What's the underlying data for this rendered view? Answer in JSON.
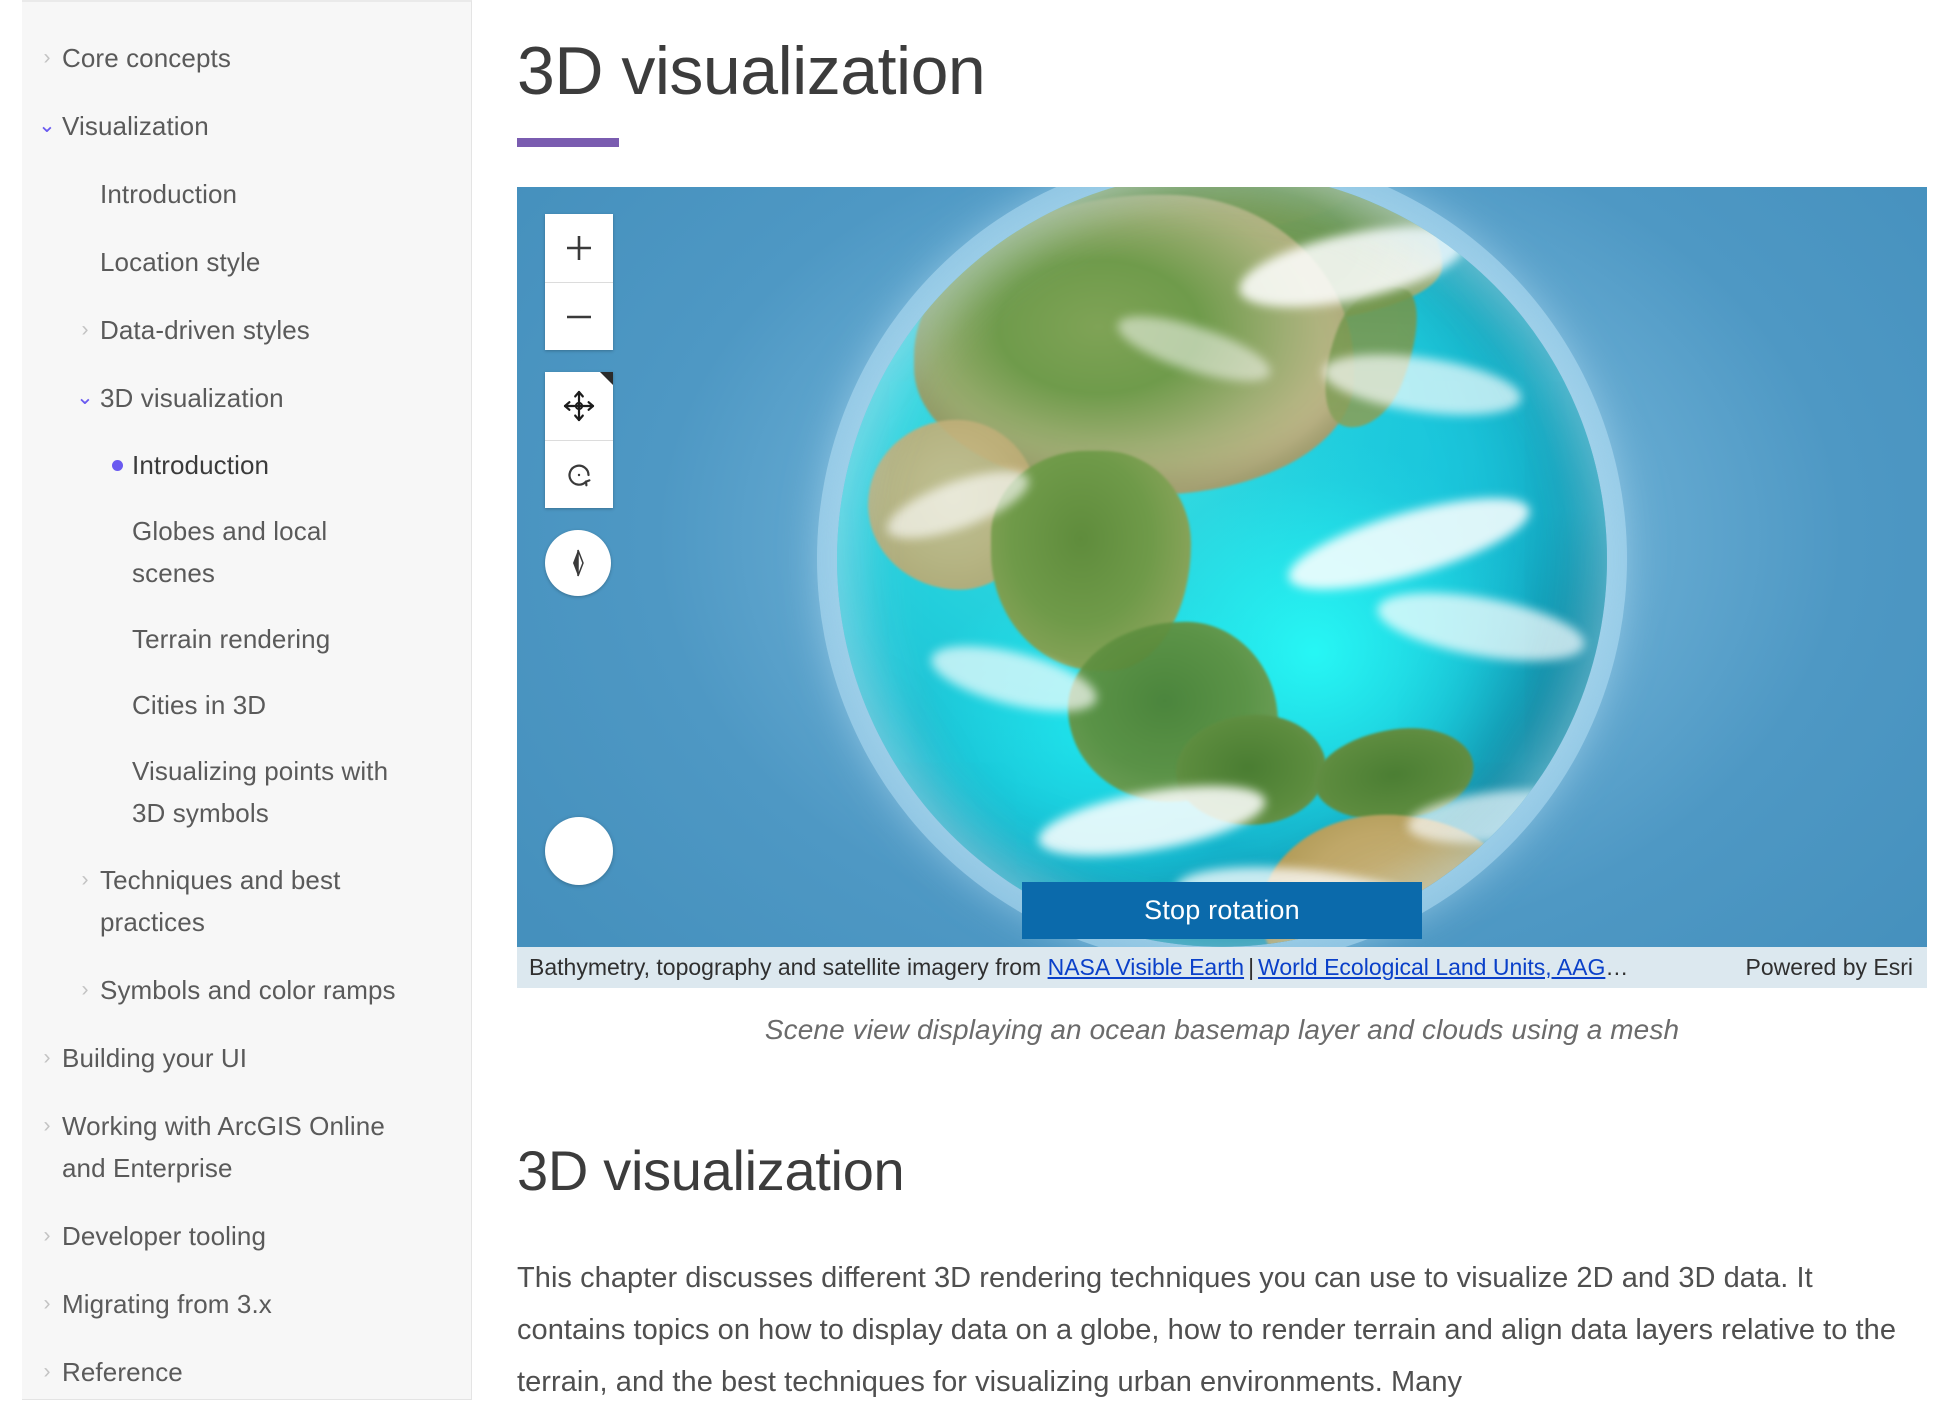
{
  "sidebar": {
    "items": [
      {
        "label": "Core concepts",
        "level": 0,
        "twist": "collapsed",
        "active": false
      },
      {
        "label": "Visualization",
        "level": 0,
        "twist": "expanded",
        "active": false
      },
      {
        "label": "Introduction",
        "level": 1,
        "twist": "none",
        "active": false
      },
      {
        "label": "Location style",
        "level": 1,
        "twist": "none",
        "active": false
      },
      {
        "label": "Data-driven styles",
        "level": 1,
        "twist": "collapsed",
        "active": false
      },
      {
        "label": "3D visualization",
        "level": 1,
        "twist": "expanded",
        "active": false
      },
      {
        "label": "Introduction",
        "level": 2,
        "twist": "bullet",
        "active": true
      },
      {
        "label": "Globes and local scenes",
        "level": 2,
        "twist": "none",
        "active": false
      },
      {
        "label": "Terrain rendering",
        "level": 2,
        "twist": "none",
        "active": false
      },
      {
        "label": "Cities in 3D",
        "level": 2,
        "twist": "none",
        "active": false
      },
      {
        "label": "Visualizing points with 3D symbols",
        "level": 2,
        "twist": "none",
        "active": false
      },
      {
        "label": "Techniques and best practices",
        "level": 1,
        "twist": "collapsed",
        "active": false
      },
      {
        "label": "Symbols and color ramps",
        "level": 1,
        "twist": "collapsed",
        "active": false
      },
      {
        "label": "Building your UI",
        "level": 0,
        "twist": "collapsed",
        "active": false
      },
      {
        "label": "Working with ArcGIS Online and Enterprise",
        "level": 0,
        "twist": "collapsed",
        "active": false
      },
      {
        "label": "Developer tooling",
        "level": 0,
        "twist": "collapsed",
        "active": false
      },
      {
        "label": "Migrating from 3.x",
        "level": 0,
        "twist": "collapsed",
        "active": false
      },
      {
        "label": "Reference",
        "level": 0,
        "twist": "collapsed",
        "active": false
      }
    ],
    "chevron_collapsed": "›",
    "chevron_expanded": "⌄"
  },
  "main": {
    "page_title": "3D visualization",
    "section_heading": "3D visualization",
    "body_paragraph": "This chapter discusses different 3D rendering techniques you can use to visualize 2D and 3D data. It contains topics on how to display data on a globe, how to render terrain and align data layers relative to the terrain, and the best techniques for visualizing urban environments. Many"
  },
  "scene": {
    "caption": "Scene view displaying an ocean basemap layer and clouds using a mesh",
    "stop_rotation_label": "Stop rotation",
    "widgets": {
      "zoom_in": "+",
      "zoom_out": "−",
      "pan": "pan-icon",
      "rotate": "rotate-icon",
      "compass": "compass-icon",
      "circle": "circle-button"
    },
    "attribution": {
      "prefix": "Bathymetry, topography and satellite imagery from ",
      "link1": "NASA Visible Earth",
      "separator": "|",
      "link2": "World Ecological Land Units, AAG",
      "ellipsis": "…",
      "powered_by": "Powered by Esri"
    }
  },
  "colors": {
    "accent_purple": "#7a5cb0",
    "active_indigo": "#6a5af0",
    "stop_rotation_blue": "#0b6aab",
    "attribution_bg": "#dce8ef",
    "sidebar_bg": "#f7f7f7",
    "scene_bg": "#4590bd",
    "link_blue": "#0a40c9"
  }
}
